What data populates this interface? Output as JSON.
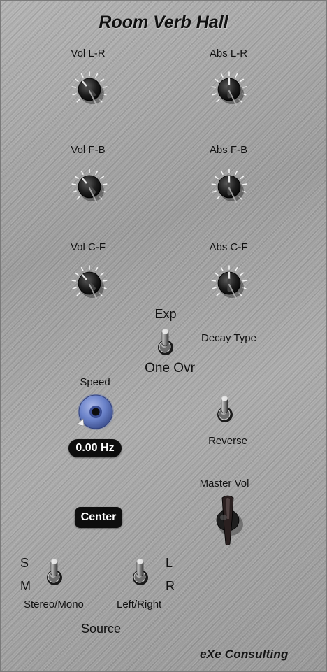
{
  "title": "Room Verb Hall",
  "brand": "eXe Consulting",
  "knobs": {
    "vol_lr": "Vol L-R",
    "abs_lr": "Abs L-R",
    "vol_fb": "Vol F-B",
    "abs_fb": "Abs F-B",
    "vol_cf": "Vol C-F",
    "abs_cf": "Abs C-F"
  },
  "decay": {
    "top_option": "Exp",
    "bottom_option": "One Ovr",
    "label": "Decay Type"
  },
  "speed": {
    "label": "Speed",
    "value": "0.00 Hz"
  },
  "reverse_label": "Reverse",
  "master_vol_label": "Master Vol",
  "center_button_label": "Center",
  "stereo_mono": {
    "top_option": "S",
    "bottom_option": "M",
    "label": "Stereo/Mono"
  },
  "left_right": {
    "top_option": "L",
    "bottom_option": "R",
    "label": "Left/Right"
  },
  "source_label": "Source",
  "colors": {
    "panel": "#a4a4a4",
    "knob": "#1c1c1c",
    "speed_knob": "#6a82c9",
    "display": "#0d0d0d"
  },
  "icons": {
    "knob": "rotary-knob-icon",
    "toggle": "toggle-switch-icon",
    "master": "chicken-head-knob-icon"
  }
}
